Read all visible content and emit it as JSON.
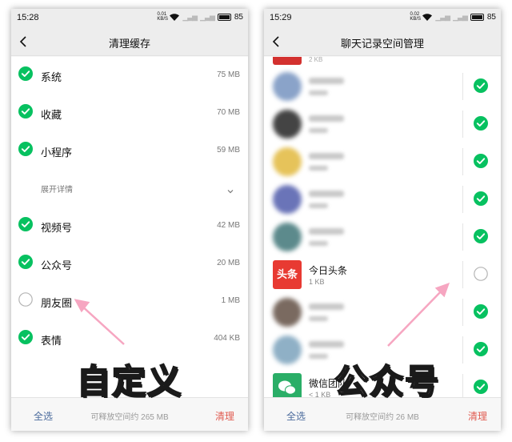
{
  "left": {
    "status_time": "15:28",
    "net_speed": "0.01\nKB/S",
    "battery": "85",
    "title": "清理缓存",
    "items_top": [
      {
        "label": "系统",
        "size": "75 MB",
        "checked": true
      },
      {
        "label": "收藏",
        "size": "70 MB",
        "checked": true
      },
      {
        "label": "小程序",
        "size": "59 MB",
        "checked": true
      }
    ],
    "expand_label": "展开详情",
    "items_bottom": [
      {
        "label": "视频号",
        "size": "42 MB",
        "checked": true
      },
      {
        "label": "公众号",
        "size": "20 MB",
        "checked": true
      },
      {
        "label": "朋友圈",
        "size": "1 MB",
        "checked": false
      },
      {
        "label": "表情",
        "size": "404 KB",
        "checked": true
      }
    ],
    "bottom": {
      "select_all": "全选",
      "info": "可释放空间约 265 MB",
      "clear": "清理"
    }
  },
  "right": {
    "status_time": "15:29",
    "net_speed": "0.02\nKB/S",
    "battery": "85",
    "title": "聊天记录空间管理",
    "partial_sub": "2 KB",
    "toutiao": {
      "logo_text": "头条",
      "name": "今日头条",
      "size": "1 KB"
    },
    "wechat_team": {
      "name": "微信团队",
      "size": "< 1 KB"
    },
    "bottom": {
      "select_all": "全选",
      "info": "可释放空间约 26 MB",
      "clear": "清理"
    }
  },
  "annotations": {
    "left_text": "自定义",
    "right_text": "公众号"
  },
  "colors": {
    "check_green": "#07c160",
    "accent_red": "#e05a4f",
    "link_blue": "#4a6a9c",
    "arrow_pink": "#f6a6c1"
  }
}
